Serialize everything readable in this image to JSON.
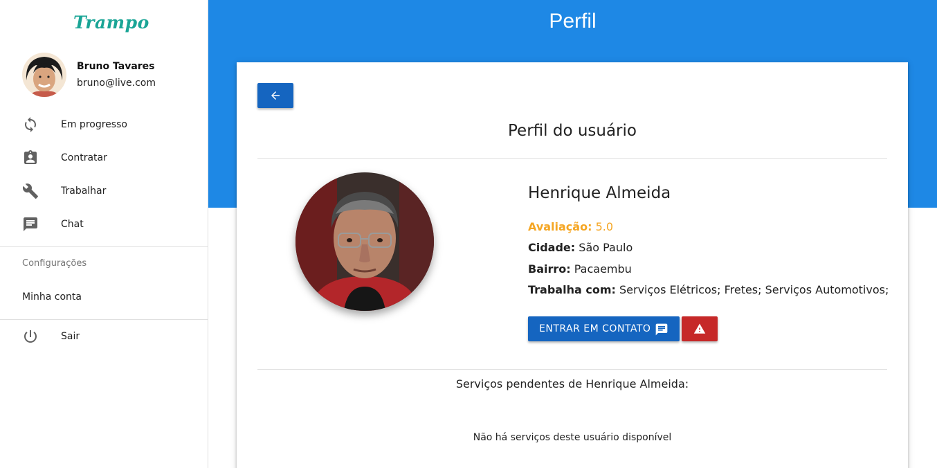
{
  "app": {
    "logo": "Trampo"
  },
  "user": {
    "name": "Bruno Tavares",
    "email": "bruno@live.com"
  },
  "sidebar": {
    "items": [
      {
        "label": "Em progresso",
        "icon": "sync-icon"
      },
      {
        "label": "Contratar",
        "icon": "assignment-ind-icon"
      },
      {
        "label": "Trabalhar",
        "icon": "wrench-icon"
      },
      {
        "label": "Chat",
        "icon": "chat-icon"
      }
    ],
    "settings_header": "Configurações",
    "account_item": "Minha conta",
    "logout": {
      "label": "Sair",
      "icon": "power-icon"
    }
  },
  "header": {
    "title": "Perfil"
  },
  "profile": {
    "title": "Perfil do usuário",
    "name": "Henrique Almeida",
    "rating_label": "Avaliação:",
    "rating_value": "5.0",
    "city_label": "Cidade:",
    "city_value": "São Paulo",
    "district_label": "Bairro:",
    "district_value": "Pacaembu",
    "works_label": "Trabalha com:",
    "works_value": "Serviços Elétricos; Fretes; Serviços Automotivos;",
    "contact_button": "ENTRAR EM CONTATO"
  },
  "pending": {
    "title": "Serviços pendentes de Henrique Almeida:",
    "empty": "Não há serviços deste usuário disponível"
  },
  "colors": {
    "primary": "#1e88e5",
    "button": "#1565c0",
    "danger": "#c62828",
    "rating": "#f5a623",
    "logo": "#1aa596"
  }
}
